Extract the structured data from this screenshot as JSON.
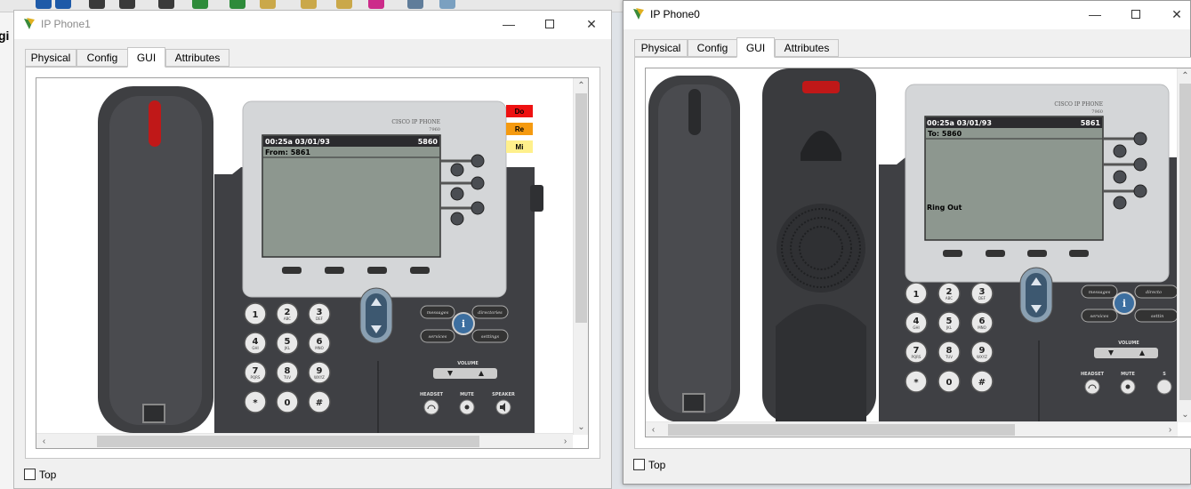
{
  "background": {
    "partial_text": "gi",
    "toolbar_colors": [
      "#1e5aa8",
      "#1e5aa8",
      "#3a3a3a",
      "#3a3a3a",
      "#3a3a3a",
      "#2e8b3a",
      "#2e8b3a",
      "#caa84a",
      "#caa84a",
      "#caa84a",
      "#cc2b8a",
      "#607d9a",
      "#7aa0c0"
    ]
  },
  "phone1_window": {
    "title": "IP Phone1",
    "tabs": [
      "Physical",
      "Config",
      "GUI",
      "Attributes"
    ],
    "active_tab": "GUI",
    "top_checkbox_label": "Top",
    "top_checked": false,
    "side_buttons": [
      {
        "label": "Do",
        "color": "#ee1111"
      },
      {
        "label": "Re",
        "color": "#f59a10"
      },
      {
        "label": "Mi",
        "color": "#fff08c"
      }
    ],
    "phone": {
      "brand": "CISCO IP PHONE",
      "model": "7960",
      "datetime": "00:25a 03/01/93",
      "extension": "5860",
      "line1": "From: 5861",
      "status": ""
    }
  },
  "phone0_window": {
    "title": "IP Phone0",
    "tabs": [
      "Physical",
      "Config",
      "GUI",
      "Attributes"
    ],
    "active_tab": "GUI",
    "top_checkbox_label": "Top",
    "top_checked": false,
    "phone": {
      "brand": "CISCO IP PHONE",
      "model": "7960",
      "datetime": "00:25a 03/01/93",
      "extension": "5861",
      "line1": "To: 5860",
      "status": "Ring Out"
    }
  },
  "keypad": [
    {
      "key": "1",
      "sub": ""
    },
    {
      "key": "2",
      "sub": "ABC"
    },
    {
      "key": "3",
      "sub": "DEF"
    },
    {
      "key": "4",
      "sub": "GHI"
    },
    {
      "key": "5",
      "sub": "JKL"
    },
    {
      "key": "6",
      "sub": "MNO"
    },
    {
      "key": "7",
      "sub": "PQRS"
    },
    {
      "key": "8",
      "sub": "TUV"
    },
    {
      "key": "9",
      "sub": "WXYZ"
    },
    {
      "key": "*",
      "sub": ""
    },
    {
      "key": "0",
      "sub": ""
    },
    {
      "key": "#",
      "sub": ""
    }
  ],
  "phone_buttons": {
    "messages": "messages",
    "directories": "directories",
    "services": "services",
    "settings": "settings",
    "info": "i",
    "volume": "VOLUME",
    "headset": "HEADSET",
    "mute": "MUTE",
    "speaker": "SPEAKER"
  },
  "phone0_partial_buttons": {
    "directories": "directo",
    "settings": "settin",
    "speaker": "S"
  }
}
